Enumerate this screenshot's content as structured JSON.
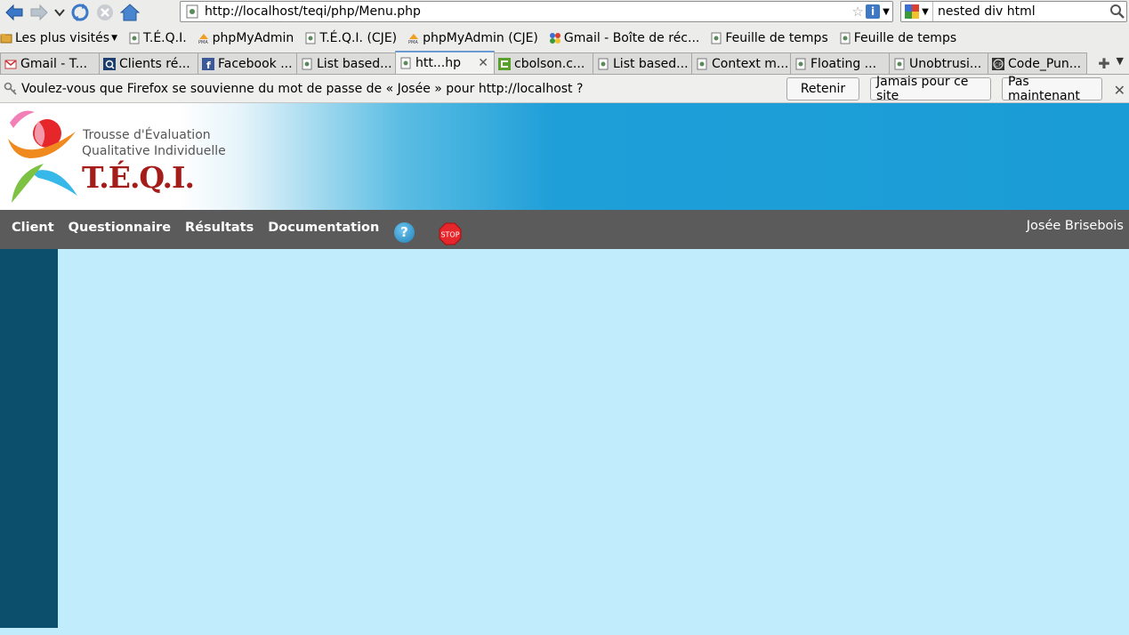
{
  "browser": {
    "url": "http://localhost/teqi/php/Menu.php",
    "search_query": "nested div html",
    "bookmarks": [
      {
        "label": "Les plus visités",
        "icon": "folder-icon"
      },
      {
        "label": "T.É.Q.I.",
        "icon": "page-icon"
      },
      {
        "label": "phpMyAdmin",
        "icon": "pma-icon"
      },
      {
        "label": "T.É.Q.I. (CJE)",
        "icon": "page-icon"
      },
      {
        "label": "phpMyAdmin (CJE)",
        "icon": "pma-icon"
      },
      {
        "label": "Gmail - Boîte de réc...",
        "icon": "google-icon"
      },
      {
        "label": "Feuille de temps",
        "icon": "page-icon"
      },
      {
        "label": "Feuille de temps",
        "icon": "page-icon"
      }
    ],
    "tabs": [
      {
        "label": "Gmail - T...",
        "icon": "gmail-icon"
      },
      {
        "label": "Clients ré...",
        "icon": "q-icon"
      },
      {
        "label": "Facebook ...",
        "icon": "facebook-icon"
      },
      {
        "label": "List based...",
        "icon": "page-icon"
      },
      {
        "label": "htt...hp",
        "icon": "page-icon",
        "active": true
      },
      {
        "label": "cbolson.c...",
        "icon": "cbolson-icon"
      },
      {
        "label": "List based...",
        "icon": "page-icon"
      },
      {
        "label": "Context m...",
        "icon": "page-icon"
      },
      {
        "label": "Floating ...",
        "icon": "page-icon"
      },
      {
        "label": "Unobtrusi...",
        "icon": "page-icon"
      },
      {
        "label": "Code_Pun...",
        "icon": "cp-icon"
      }
    ],
    "password_bar": {
      "message": "Voulez-vous que Firefox se souvienne du mot de passe de « Josée » pour http://localhost ?",
      "remember": "Retenir",
      "never": "Jamais pour ce site",
      "not_now": "Pas maintenant"
    }
  },
  "page": {
    "logo": {
      "line1": "Trousse d'Évaluation",
      "line2": "Qualitative Individuelle",
      "brand": "T.É.Q.I."
    },
    "menu": [
      "Client",
      "Questionnaire",
      "Résultats",
      "Documentation"
    ],
    "help_glyph": "?",
    "stop_label": "STOP",
    "user_name": "Josée Brisebois"
  },
  "colors": {
    "menubar": "#5b5b5b",
    "sidebar": "#0b4f6c",
    "main": "#c0ecfb",
    "banner_blue": "#1a9cd6",
    "brand_red": "#a41d1a"
  }
}
